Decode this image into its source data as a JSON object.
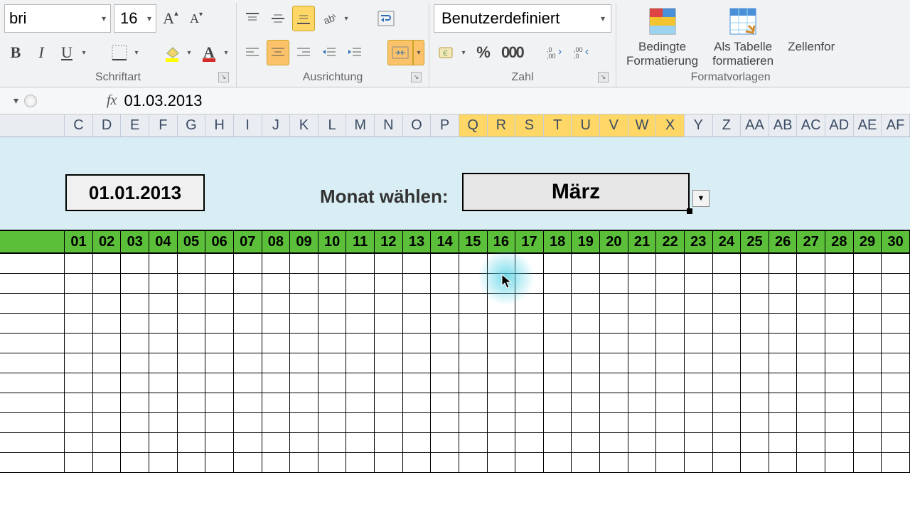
{
  "ribbon": {
    "font_group_label": "Schriftart",
    "align_group_label": "Ausrichtung",
    "number_group_label": "Zahl",
    "styles_group_label": "Formatvorlagen",
    "font_name": "bri",
    "font_size": "16",
    "number_format": "Benutzerdefiniert",
    "cond_fmt_label": "Bedingte\nFormatierung",
    "table_fmt_label": "Als Tabelle\nformatieren",
    "cell_fmt_label": "Zellenfor"
  },
  "formula_bar": {
    "fx_label": "fx",
    "value": "01.03.2013"
  },
  "columns": [
    "C",
    "D",
    "E",
    "F",
    "G",
    "H",
    "I",
    "J",
    "K",
    "L",
    "M",
    "N",
    "O",
    "P",
    "Q",
    "R",
    "S",
    "T",
    "U",
    "V",
    "W",
    "X",
    "Y",
    "Z",
    "AA",
    "AB",
    "AC",
    "AD",
    "AE",
    "AF"
  ],
  "selected_columns": [
    "Q",
    "R",
    "S",
    "T",
    "U",
    "V",
    "W",
    "X"
  ],
  "sheet": {
    "date_box": "01.01.2013",
    "month_label": "Monat wählen:",
    "month_value": "März"
  },
  "days": [
    "01",
    "02",
    "03",
    "04",
    "05",
    "06",
    "07",
    "08",
    "09",
    "10",
    "11",
    "12",
    "13",
    "14",
    "15",
    "16",
    "17",
    "18",
    "19",
    "20",
    "21",
    "22",
    "23",
    "24",
    "25",
    "26",
    "27",
    "28",
    "29",
    "30"
  ],
  "icons": {
    "bold": "B",
    "italic": "I",
    "underline": "U",
    "percent": "%"
  },
  "colors": {
    "highlight_fill": "#ffff00",
    "font_color": "#d42a2a",
    "ribbon_active": "#ffd767"
  }
}
